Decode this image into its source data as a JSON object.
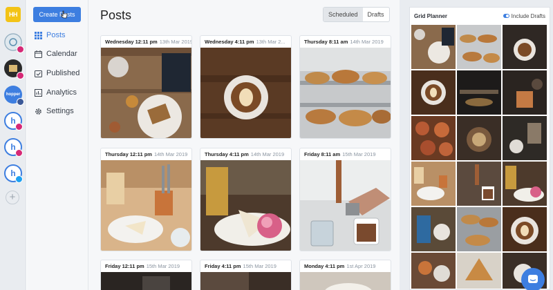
{
  "rail": {
    "logo": "HH",
    "accounts": [
      {
        "name": "acct-1",
        "badge": "ig",
        "initial": "",
        "color": "#5b8fb0"
      },
      {
        "name": "acct-2",
        "badge": "ig",
        "initial": "",
        "color": "#2a2a2a"
      },
      {
        "name": "acct-3",
        "badge": "fb",
        "initial": "hopper",
        "color": "#3d7ee0"
      },
      {
        "name": "acct-4",
        "badge": "ig",
        "initial": "h",
        "color": "#3d7ee0"
      },
      {
        "name": "acct-5",
        "badge": "ig",
        "initial": "h",
        "color": "#3d7ee0"
      },
      {
        "name": "acct-6",
        "badge": "tw",
        "initial": "h",
        "color": "#3d7ee0"
      }
    ],
    "add_label": "+"
  },
  "nav": {
    "create_label": "Create Posts",
    "items": [
      {
        "label": "Posts",
        "icon": "grid-icon",
        "active": true
      },
      {
        "label": "Calendar",
        "icon": "calendar-icon",
        "active": false
      },
      {
        "label": "Published",
        "icon": "published-icon",
        "active": false
      },
      {
        "label": "Analytics",
        "icon": "analytics-icon",
        "active": false
      },
      {
        "label": "Settings",
        "icon": "gear-icon",
        "active": false
      }
    ]
  },
  "main": {
    "title": "Posts",
    "tabs": [
      {
        "label": "Scheduled",
        "active": true
      },
      {
        "label": "Drafts",
        "active": false
      }
    ],
    "posts": [
      {
        "time": "Wednesday 12:11 pm",
        "date": "13th Mar 2019"
      },
      {
        "time": "Wednesday 4:11 pm",
        "date": "13th Mar 2..."
      },
      {
        "time": "Thursday 8:11 am",
        "date": "14th Mar 2019"
      },
      {
        "time": "Thursday 12:11 pm",
        "date": "14th Mar 2019"
      },
      {
        "time": "Thursday 4:11 pm",
        "date": "14th Mar 2019"
      },
      {
        "time": "Friday 8:11 am",
        "date": "15th Mar 2019"
      },
      {
        "time": "Friday 12:11 pm",
        "date": "15th Mar 2019"
      },
      {
        "time": "Friday 4:11 pm",
        "date": "15th Mar 2019"
      },
      {
        "time": "Monday 4:11 pm",
        "date": "1st Apr 2019"
      }
    ]
  },
  "planner": {
    "title": "Grid Planner",
    "include_label": "Include Drafts"
  },
  "colors": {
    "accent": "#3d7ee0"
  }
}
